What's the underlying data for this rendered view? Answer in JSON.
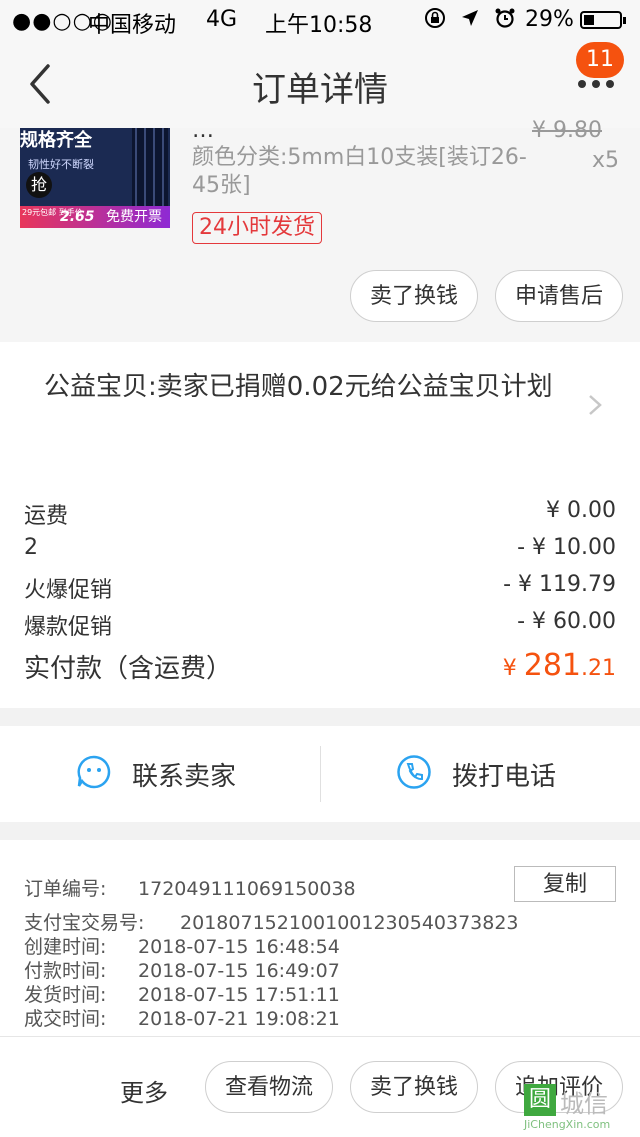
{
  "status_bar": {
    "signal": "●●○○○",
    "carrier": "中国移动",
    "network": "4G",
    "time": "上午10:58",
    "battery": "29%",
    "battery_level": 0.29
  },
  "nav": {
    "title": "订单详情",
    "badge": "11"
  },
  "product": {
    "name": "…",
    "sku": "颜色分类:5mm白10支装[装订26-45张]",
    "price": "¥ 9.80",
    "qty": "x5",
    "ship_tag": "24小时发货",
    "thumb": {
      "headline": "规格齐全",
      "sub": "韧性好不断裂",
      "grab": "抢",
      "price": "2.65",
      "free_invoice": "免费开票",
      "promo": "29元包邮 到手价"
    },
    "buttons": [
      "卖了换钱",
      "申请售后"
    ]
  },
  "charity": {
    "text": "公益宝贝:卖家已捐赠0.02元给公益宝贝计划"
  },
  "fees": [
    {
      "label": "运费",
      "value": "¥ 0.00"
    },
    {
      "label": "2",
      "value": "- ¥ 10.00"
    },
    {
      "label": "火爆促销",
      "value": "- ¥ 119.79"
    },
    {
      "label": "爆款促销",
      "value": "- ¥ 60.00"
    }
  ],
  "total": {
    "label": "实付款（含运费）",
    "currency": "¥",
    "int": "281",
    "dec": ".21"
  },
  "contact": {
    "seller": "联系卖家",
    "phone": "拨打电话"
  },
  "order_info": {
    "copy_label": "复制",
    "rows": [
      {
        "key": "订单编号:",
        "value": "172049111069150038"
      },
      {
        "key": "支付宝交易号:",
        "value": "2018071521001001230540373823"
      },
      {
        "key": "创建时间:",
        "value": "2018-07-15 16:48:54"
      },
      {
        "key": "付款时间:",
        "value": "2018-07-15 16:49:07"
      },
      {
        "key": "发货时间:",
        "value": "2018-07-15 17:51:11"
      },
      {
        "key": "成交时间:",
        "value": "2018-07-21 19:08:21"
      }
    ]
  },
  "bottom_bar": {
    "more": "更多",
    "buttons": [
      "查看物流",
      "卖了换钱",
      "追加评价"
    ]
  },
  "watermark": {
    "glyph": "圆",
    "name": "城信",
    "url": "JiChengXin.com"
  },
  "colors": {
    "accent": "#f5520f",
    "tag_red": "#e4393c",
    "icon_blue": "#2ba3f0"
  }
}
